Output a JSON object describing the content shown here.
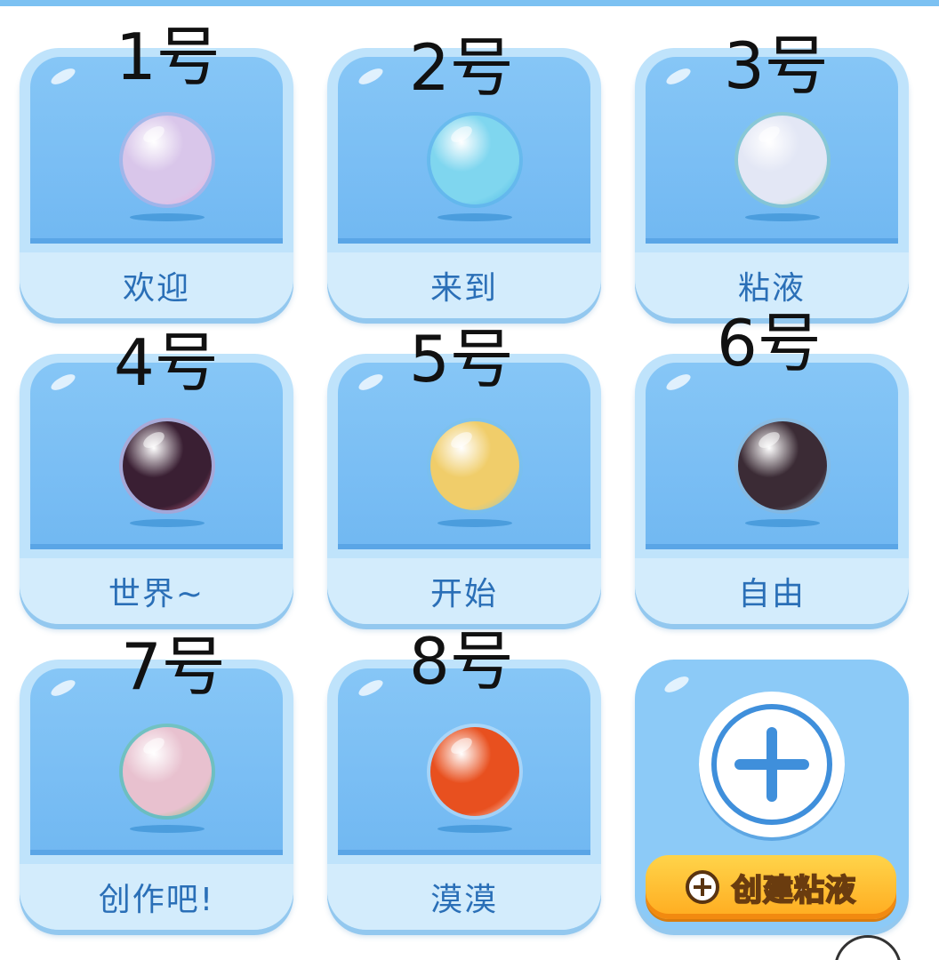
{
  "slots": [
    {
      "number": "1号",
      "label": "欢迎",
      "ball_color": "#d9c6ea",
      "ball_accent": "#f0a9d8"
    },
    {
      "number": "2号",
      "label": "来到",
      "ball_color": "#7fd6ef",
      "ball_accent": "#3fb2e2"
    },
    {
      "number": "3号",
      "label": "粘液",
      "ball_color": "#e3e7f5",
      "ball_accent": "#9fd79a"
    },
    {
      "number": "4号",
      "label": "世界~",
      "ball_color": "#3a1f33",
      "ball_accent": "#ff7fa3"
    },
    {
      "number": "5号",
      "label": "开始",
      "ball_color": "#f0cd6a",
      "ball_accent": "#7ac3e4"
    },
    {
      "number": "6号",
      "label": "自由",
      "ball_color": "#3b2b35",
      "ball_accent": "#9bb3c4"
    },
    {
      "number": "7号",
      "label": "创作吧!",
      "ball_color": "#e8c1cf",
      "ball_accent": "#56c45a"
    },
    {
      "number": "8号",
      "label": "漠漠",
      "ball_color": "#e8501f",
      "ball_accent": "#ffffff"
    }
  ],
  "create_button": {
    "label": "创建粘液",
    "icon": "plus-circle-icon"
  },
  "add_icon": "plus-icon"
}
